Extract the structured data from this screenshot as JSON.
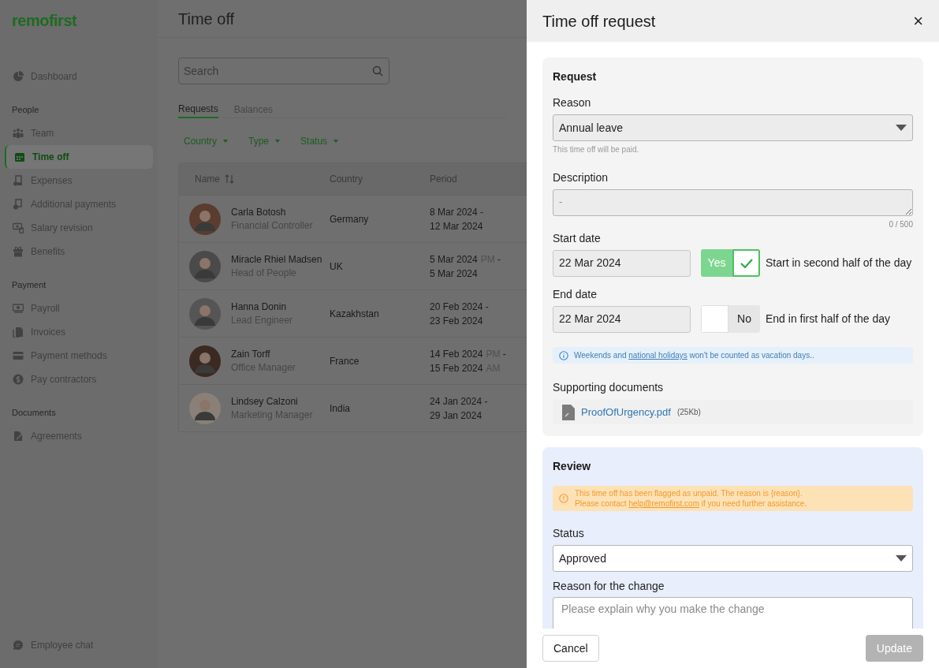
{
  "brand": "remofirst",
  "page_title": "Time off",
  "sidebar": {
    "groups": [
      {
        "items": [
          {
            "label": "Dashboard",
            "selected": false
          }
        ]
      },
      {
        "heading": "People",
        "items": [
          {
            "label": "Team",
            "selected": false
          },
          {
            "label": "Time off",
            "selected": true
          },
          {
            "label": "Expenses",
            "selected": false
          },
          {
            "label": "Additional payments",
            "selected": false
          },
          {
            "label": "Salary revision",
            "selected": false
          },
          {
            "label": "Benefits",
            "selected": false
          }
        ]
      },
      {
        "heading": "Payment",
        "items": [
          {
            "label": "Payroll",
            "selected": false
          },
          {
            "label": "Invoices",
            "selected": false
          },
          {
            "label": "Payment methods",
            "selected": false
          },
          {
            "label": "Pay contractors",
            "selected": false
          }
        ]
      },
      {
        "heading": "Documents",
        "items": [
          {
            "label": "Agreements",
            "selected": false
          }
        ]
      }
    ],
    "footer_item": "Employee chat"
  },
  "search": {
    "placeholder": "Search"
  },
  "tabs": [
    {
      "label": "Requests",
      "selected": true
    },
    {
      "label": "Balances",
      "selected": false
    }
  ],
  "filters": [
    "Country",
    "Type",
    "Status"
  ],
  "table": {
    "columns": [
      "Name",
      "Country",
      "Period"
    ],
    "rows": [
      {
        "name": "Carla Botosh",
        "role": "Financial Controller",
        "country": "Germany",
        "period": [
          {
            "date": "8 Mar 2024",
            "sep": "-"
          },
          {
            "date": "12 Mar 2024"
          }
        ]
      },
      {
        "name": "Miracle Rhiel Madsen",
        "role": "Head of People",
        "country": "UK",
        "period": [
          {
            "date": "5 Mar 2024",
            "half": "PM",
            "sep": "-"
          },
          {
            "date": "5 Mar 2024"
          }
        ]
      },
      {
        "name": "Hanna Donin",
        "role": "Lead Engineer",
        "country": "Kazakhstan",
        "period": [
          {
            "date": "20 Feb 2024",
            "sep": "-"
          },
          {
            "date": "23 Feb 2024"
          }
        ]
      },
      {
        "name": "Zain Torff",
        "role": "Office Manager",
        "country": "France",
        "period": [
          {
            "date": "14 Feb 2024",
            "half": "PM",
            "sep": "-"
          },
          {
            "date": "15 Feb 2024",
            "half": "AM"
          }
        ]
      },
      {
        "name": "Lindsey Calzoni",
        "role": "Marketing Manager",
        "country": "India",
        "period": [
          {
            "date": "24 Jan 2024",
            "sep": "-"
          },
          {
            "date": "29 Jan 2024"
          }
        ]
      }
    ]
  },
  "drawer": {
    "title": "Time off request",
    "close": "×",
    "request": {
      "title": "Request",
      "reason": {
        "label": "Reason",
        "value": "Annual leave",
        "hint": "This time off will be paid."
      },
      "description": {
        "label": "Description",
        "placeholder": "-",
        "counter": "0 / 500"
      },
      "start_date": {
        "label": "Start date",
        "value": "22 Mar 2024",
        "toggle": {
          "label": "Yes",
          "on": true
        },
        "caption": "Start in second half of the day"
      },
      "end_date": {
        "label": "End date",
        "value": "22 Mar 2024",
        "toggle": {
          "label": "No",
          "on": false
        },
        "caption": "End in first half of the day"
      },
      "note": {
        "before": "Weekends and",
        "link": "national holidays",
        "after": "won't be counted as vacation days.."
      },
      "documents": {
        "label": "Supporting documents",
        "files": [
          {
            "name": "ProofOfUrgency.pdf",
            "size": "(25Kb)"
          }
        ]
      }
    },
    "review": {
      "title": "Review",
      "warning": {
        "text": "This time off has been flagged as unpaid. The reason is {reason}.",
        "before": "Please contact",
        "link": "help@remofirst.com",
        "after": "if you need further assistance."
      },
      "status": {
        "label": "Status",
        "value": "Approved"
      },
      "change_reason": {
        "label": "Reason for the change",
        "placeholder": "Please explain why you make the change"
      }
    },
    "buttons": {
      "cancel": "Cancel",
      "update": "Update"
    }
  }
}
